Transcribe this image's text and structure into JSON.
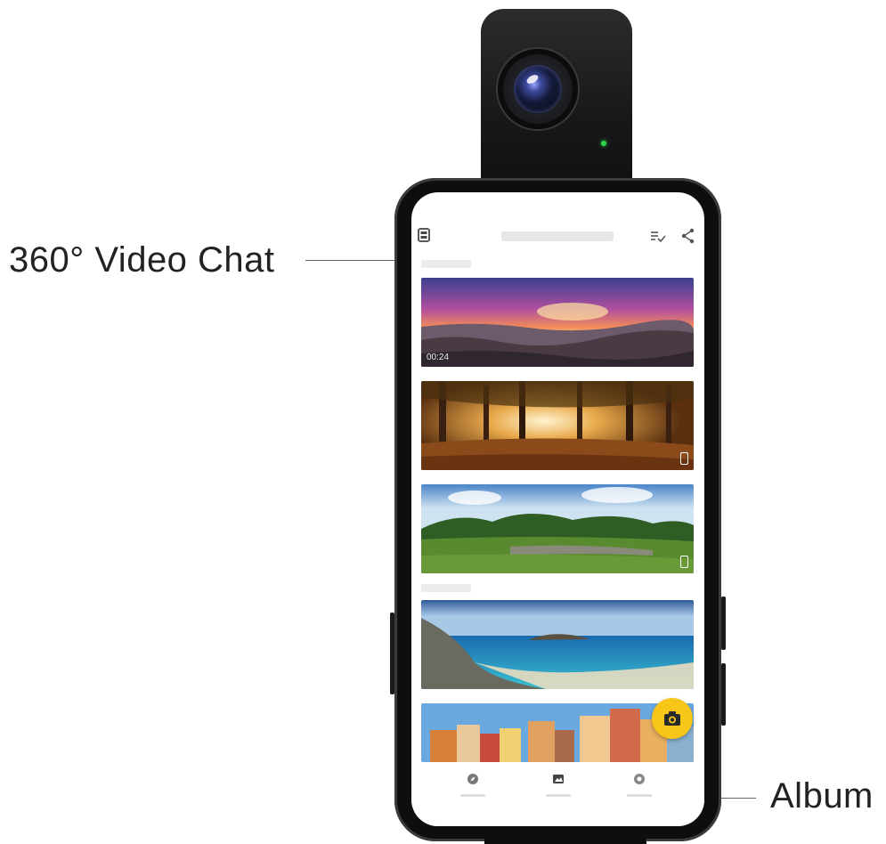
{
  "callouts": {
    "video_chat": "360° Video Chat",
    "album": "Album"
  },
  "album": {
    "first_item_duration": "00:24"
  },
  "colors": {
    "fab": "#f7c618",
    "status_led": "#2fd44a"
  },
  "icons": [
    "video-chat-icon",
    "multi-select-icon",
    "share-icon",
    "camera-icon",
    "explore-icon",
    "album-icon",
    "settings-icon"
  ]
}
